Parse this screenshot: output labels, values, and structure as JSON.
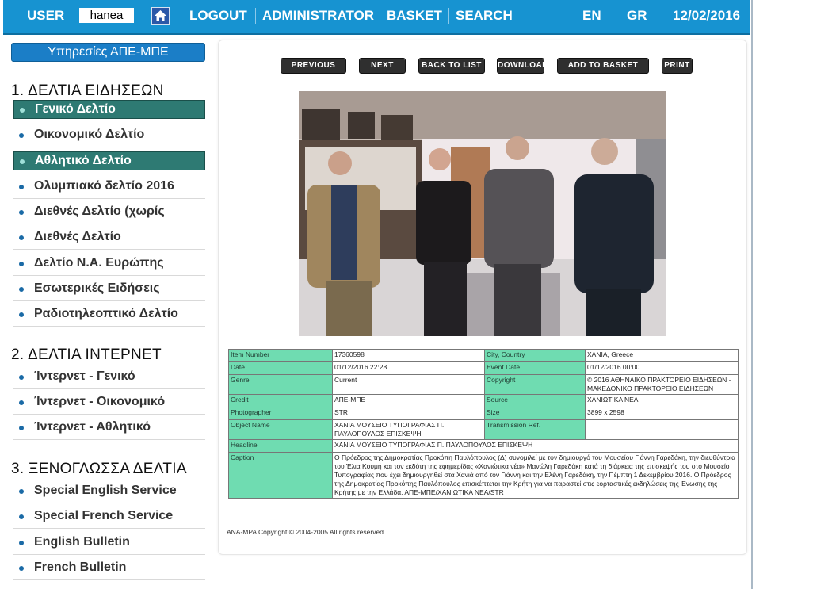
{
  "topbar": {
    "user_label": "USER",
    "user_value": "hanea",
    "logout": "LOGOUT",
    "administrator": "ADMINISTRATOR",
    "basket": "BASKET",
    "search": "SEARCH",
    "lang_en": "EN",
    "lang_gr": "GR",
    "date": "12/02/2016"
  },
  "sidebar": {
    "header": "Υπηρεσίες ΑΠΕ-ΜΠΕ",
    "sections": [
      {
        "title": "1. ΔΕΛΤΙΑ ΕΙΔΗΣΕΩΝ",
        "items": [
          {
            "label": "Γενικό Δελτίο",
            "active": true
          },
          {
            "label": "Οικονομικό Δελτίο",
            "active": false
          },
          {
            "label": "Αθλητικό Δελτίο",
            "active": true
          },
          {
            "label": "Ολυμπιακό δελτίο 2016",
            "active": false
          },
          {
            "label": "Διεθνές Δελτίο (χωρίς",
            "active": false
          },
          {
            "label": "Διεθνές Δελτίο",
            "active": false
          },
          {
            "label": "Δελτίο Ν.Α. Ευρώπης",
            "active": false
          },
          {
            "label": "Εσωτερικές Ειδήσεις",
            "active": false
          },
          {
            "label": "Ραδιοτηλεοπτικό Δελτίο",
            "active": false
          }
        ]
      },
      {
        "title": "2. ΔΕΛΤΙΑ ΙΝΤΕΡΝΕΤ",
        "items": [
          {
            "label": "Ίντερνετ - Γενικό",
            "active": false
          },
          {
            "label": "Ίντερνετ - Οικονομικό",
            "active": false
          },
          {
            "label": "Ίντερνετ - Αθλητικό",
            "active": false
          }
        ]
      },
      {
        "title": "3. ΞΕΝΟΓΛΩΣΣΑ ΔΕΛΤΙΑ",
        "items": [
          {
            "label": "Special English Service",
            "active": false
          },
          {
            "label": "Special French Service",
            "active": false
          },
          {
            "label": "English Bulletin",
            "active": false
          },
          {
            "label": "French Bulletin",
            "active": false
          }
        ]
      }
    ]
  },
  "buttons": {
    "previous": "PREVIOUS",
    "next": "NEXT",
    "back": "BACK TO LIST",
    "download": "DOWNLOAD",
    "add_basket": "ADD TO BASKET",
    "print": "PRINT"
  },
  "meta": {
    "item_number_label": "Item Number",
    "item_number": "17360598",
    "city_label": "City, Country",
    "city": "ΧΑΝΙΑ, Greece",
    "date_label": "Date",
    "date": "01/12/2016 22:28",
    "event_date_label": "Event Date",
    "event_date": "01/12/2016 00:00",
    "genre_label": "Genre",
    "genre": "Current",
    "copyright_label": "Copyright",
    "copyright": "© 2016 ΑΘΗΝΑΪΚΟ ΠΡΑΚΤΟΡΕΙΟ ΕΙΔΗΣΕΩΝ - ΜΑΚΕΔΟΝΙΚΟ ΠΡΑΚΤΟΡΕΙΟ ΕΙΔΗΣΕΩΝ",
    "credit_label": "Credit",
    "credit": "ΑΠΕ-ΜΠΕ",
    "source_label": "Source",
    "source": "ΧΑΝΙΩΤΙΚΑ ΝΕΑ",
    "photographer_label": "Photographer",
    "photographer": "STR",
    "size_label": "Size",
    "size": "3899 x 2598",
    "object_name_label": "Object Name",
    "object_name": "ΧΑΝΙΑ ΜΟΥΣΕΙΟ ΤΥΠΟΓΡΑΦΙΑΣ Π. ΠΑΥΛΟΠΟΥΛΟΣ ΕΠΙΣΚΕΨΗ",
    "transmission_label": "Transmission Ref.",
    "transmission": "",
    "headline_label": "Headline",
    "headline": "ΧΑΝΙΑ ΜΟΥΣΕΙΟ ΤΥΠΟΓΡΑΦΙΑΣ Π. ΠΑΥΛΟΠΟΥΛΟΣ ΕΠΙΣΚΕΨΗ",
    "caption_label": "Caption",
    "caption": "Ο Πρόεδρος της Δημοκρατίας Προκόπη Παυλόπουλος (Δ) συνομιλεί με τον δημιουργό του Μουσείου Γιάννη Γαρεδάκη, την διευθύντρια του Έλια Κουμή και τον εκδότη της εφημερίδας «Χανιώτικα νέα» Μανώλη Γαρεδάκη κατά τη διάρκεια της επίσκεψής του στο Μουσείο Τυπογραφίας που έχει δημιουργηθεί στα Χανιά από τον Γιάννη και την Ελένη Γαρεδάκη, την Πέμπτη 1 Δεκεμβρίου 2016. Ο Πρόεδρος της Δημοκρατίας Προκόπης Παυλόπουλος επισκέπτεται την Κρήτη για να παραστεί στις εορταστικές εκδηλώσεις της Ένωσης της Κρήτης με την Ελλάδα. ΑΠΕ-ΜΠΕ/ΧΑΝΙΩΤΙΚΑ ΝΕΑ/STR"
  },
  "footer": {
    "copyright": "ANA-MPA Copyright © 2004-2005 All rights reserved."
  }
}
